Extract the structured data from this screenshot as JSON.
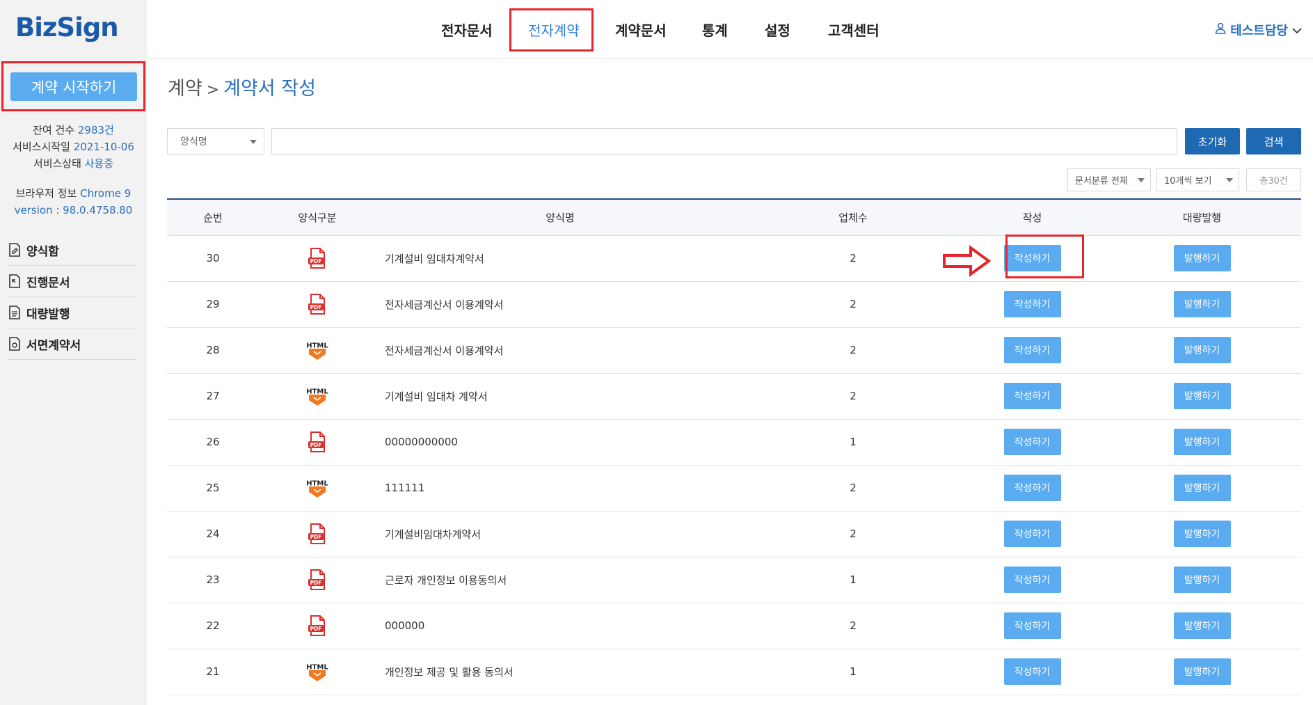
{
  "app": {
    "logo": "BizSign"
  },
  "sidebar": {
    "start_button": "계약 시작하기",
    "info": {
      "remaining_label": "잔여 건수",
      "remaining_value": "2983건",
      "start_label": "서비스시작일",
      "start_value": "2021-10-06",
      "status_label": "서비스상태",
      "status_value": "사용중",
      "browser_label": "브라우저 정보",
      "browser_value": "Chrome 9",
      "version_label": "version : 98.0.4758.80"
    },
    "menu": [
      {
        "label": "양식함",
        "icon": "form-box-icon"
      },
      {
        "label": "진행문서",
        "icon": "progress-doc-icon"
      },
      {
        "label": "대량발행",
        "icon": "bulk-issue-icon"
      },
      {
        "label": "서면계약서",
        "icon": "paper-contract-icon"
      }
    ]
  },
  "topnav": {
    "items": [
      "전자문서",
      "전자계약",
      "계약문서",
      "통계",
      "설정",
      "고객센터"
    ],
    "active_index": 1,
    "user": "테스트담당"
  },
  "breadcrumb": {
    "parent": "계약",
    "separator": ">",
    "current": "계약서 작성"
  },
  "search": {
    "field_select": "양식명",
    "input_value": "",
    "reset_label": "초기화",
    "search_label": "검색"
  },
  "filters": {
    "category": "문서분류 전체",
    "page_size": "10개씩 보기",
    "total": "총30건"
  },
  "table": {
    "headers": [
      "순번",
      "양식구분",
      "양식명",
      "업체수",
      "작성",
      "대량발행"
    ],
    "write_label": "작성하기",
    "bulk_label": "발행하기",
    "rows": [
      {
        "no": "30",
        "type": "PDF",
        "name": "기계설비 임대차계약서",
        "count": "2"
      },
      {
        "no": "29",
        "type": "PDF",
        "name": "전자세금계산서 이용계약서",
        "count": "2"
      },
      {
        "no": "28",
        "type": "HTML",
        "name": "전자세금계산서 이용계약서",
        "count": "2"
      },
      {
        "no": "27",
        "type": "HTML",
        "name": "기계설비 임대차 계약서",
        "count": "2"
      },
      {
        "no": "26",
        "type": "PDF",
        "name": "00000000000",
        "count": "1"
      },
      {
        "no": "25",
        "type": "HTML",
        "name": "111111",
        "count": "2"
      },
      {
        "no": "24",
        "type": "PDF",
        "name": "기계설비임대차계약서",
        "count": "2"
      },
      {
        "no": "23",
        "type": "PDF",
        "name": "근로자 개인정보 이용동의서",
        "count": "1"
      },
      {
        "no": "22",
        "type": "PDF",
        "name": "000000",
        "count": "2"
      },
      {
        "no": "21",
        "type": "HTML",
        "name": "개인정보 제공 및 활용 동의서",
        "count": "1"
      }
    ]
  },
  "colors": {
    "brand": "#1a5aa8",
    "accent": "#5aabf0",
    "dark_button": "#1f69b3",
    "highlight": "#e8242a"
  }
}
